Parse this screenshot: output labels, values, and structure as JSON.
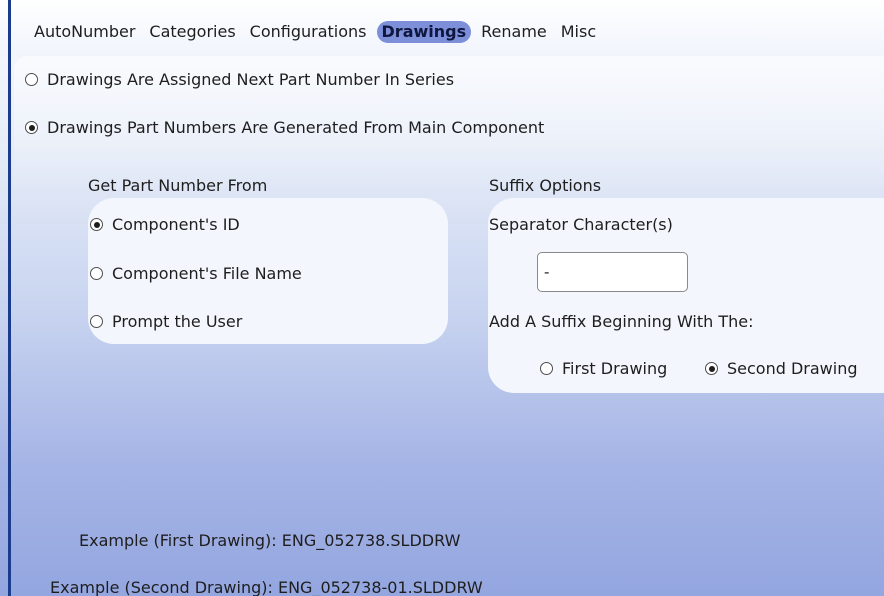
{
  "tabs": [
    {
      "label": "AutoNumber"
    },
    {
      "label": "Categories"
    },
    {
      "label": "Configurations"
    },
    {
      "label": "Drawings",
      "active": true
    },
    {
      "label": "Rename"
    },
    {
      "label": "Misc"
    }
  ],
  "mode_options": {
    "next_in_series": {
      "label": "Drawings Are Assigned Next Part Number In Series",
      "checked": false
    },
    "from_main_component": {
      "label": "Drawings Part Numbers Are Generated From Main Component",
      "checked": true
    }
  },
  "part_number_source": {
    "heading": "Get Part Number From",
    "options": [
      {
        "label": "Component's ID",
        "checked": true
      },
      {
        "label": "Component's File Name",
        "checked": false
      },
      {
        "label": "Prompt the User",
        "checked": false
      }
    ]
  },
  "suffix_options": {
    "heading": "Suffix Options",
    "separator_label": "Separator Character(s)",
    "separator_value": "-",
    "begin_label": "Add A Suffix Beginning With The:",
    "begin_options": [
      {
        "label": "First Drawing",
        "checked": false
      },
      {
        "label": "Second Drawing",
        "checked": true
      }
    ]
  },
  "examples": {
    "first": "Example (First Drawing): ENG_052738.SLDDRW",
    "second": "Example (Second Drawing): ENG_052738-01.SLDDRW"
  },
  "colors": {
    "active_tab": "#7d8fd8",
    "left_border": "#1b3c8c",
    "group_background": "#f3f6fd"
  }
}
